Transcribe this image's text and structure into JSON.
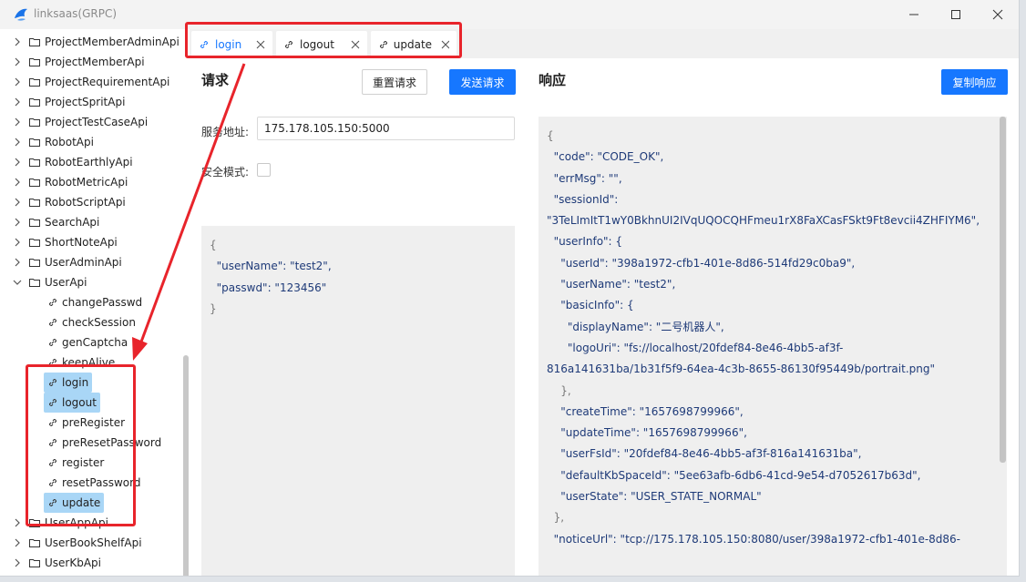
{
  "window": {
    "title": "linksaas(GRPC)",
    "controls": {
      "minimize": "minimize-icon",
      "maximize": "maximize-icon",
      "close": "close-icon"
    }
  },
  "sidebar": {
    "folders": [
      {
        "label": "ProjectMemberAdminApi"
      },
      {
        "label": "ProjectMemberApi"
      },
      {
        "label": "ProjectRequirementApi"
      },
      {
        "label": "ProjectSpritApi"
      },
      {
        "label": "ProjectTestCaseApi"
      },
      {
        "label": "RobotApi"
      },
      {
        "label": "RobotEarthlyApi"
      },
      {
        "label": "RobotMetricApi"
      },
      {
        "label": "RobotScriptApi"
      },
      {
        "label": "SearchApi"
      },
      {
        "label": "ShortNoteApi"
      },
      {
        "label": "UserAdminApi"
      },
      {
        "label": "UserApi",
        "expanded": true
      }
    ],
    "methods": [
      {
        "label": "changePasswd"
      },
      {
        "label": "checkSession"
      },
      {
        "label": "genCaptcha"
      },
      {
        "label": "keepAlive"
      },
      {
        "label": "login",
        "selected": true
      },
      {
        "label": "logout",
        "selected": true
      },
      {
        "label": "preRegister"
      },
      {
        "label": "preResetPassword"
      },
      {
        "label": "register"
      },
      {
        "label": "resetPassword"
      },
      {
        "label": "update",
        "selected": true
      }
    ],
    "folders_after": [
      {
        "label": "UserAppApi"
      },
      {
        "label": "UserBookShelfApi"
      },
      {
        "label": "UserKbApi"
      }
    ]
  },
  "tabs": [
    {
      "label": "login",
      "active": true
    },
    {
      "label": "logout"
    },
    {
      "label": "update"
    }
  ],
  "request": {
    "title": "请求",
    "reset_label": "重置请求",
    "send_label": "发送请求",
    "server_label": "服务地址:",
    "server_value": "175.178.105.150:5000",
    "secure_label": "安全模式:",
    "body_lines": [
      "{",
      "  \"userName\": \"test2\",",
      "  \"passwd\": \"123456\"",
      "}"
    ]
  },
  "response": {
    "title": "响应",
    "copy_label": "复制响应",
    "body_lines": [
      "{",
      "  \"code\": \"CODE_OK\",",
      "  \"errMsg\": \"\",",
      "  \"sessionId\":",
      "\"3TeLImItT1wY0BkhnUI2IVqUQOCQHFmeu1rX8FaXCasFSkt9Ft8evcii4ZHFIYM6\",",
      "  \"userInfo\": {",
      "    \"userId\": \"398a1972-cfb1-401e-8d86-514fd29c0ba9\",",
      "    \"userName\": \"test2\",",
      "    \"basicInfo\": {",
      "      \"displayName\": \"二号机器人\",",
      "      \"logoUri\": \"fs://localhost/20fdef84-8e46-4bb5-af3f-",
      "816a141631ba/1b31f5f9-64ea-4c3b-8655-86130f95449b/portrait.png\"",
      "    },",
      "    \"createTime\": \"1657698799966\",",
      "    \"updateTime\": \"1657698799966\",",
      "    \"userFsId\": \"20fdef84-8e46-4bb5-af3f-816a141631ba\",",
      "    \"defaultKbSpaceId\": \"5ee63afb-6db6-41cd-9e54-d7052617b63d\",",
      "    \"userState\": \"USER_STATE_NORMAL\"",
      "  },",
      "  \"noticeUrl\": \"tcp://175.178.105.150:8080/user/398a1972-cfb1-401e-8d86-"
    ]
  },
  "colors": {
    "accent": "#1677ff",
    "selection": "#a9d6f6",
    "annotation": "#e8242b"
  }
}
